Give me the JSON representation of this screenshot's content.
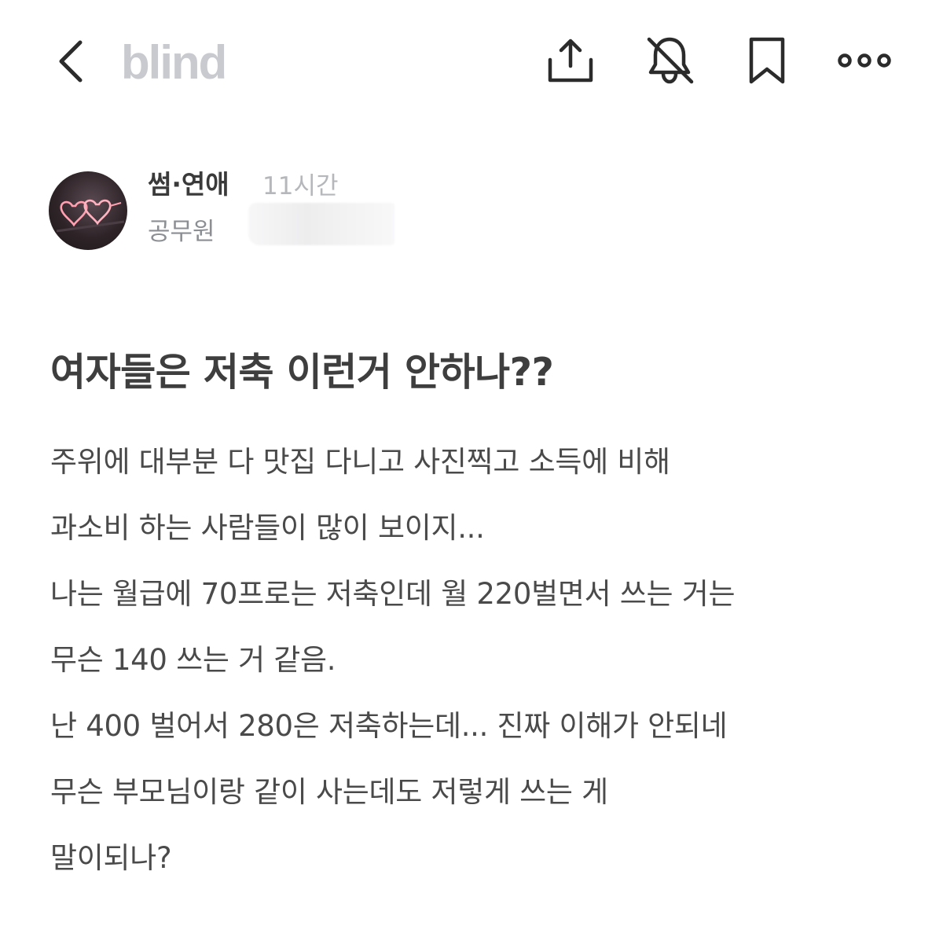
{
  "header": {
    "logo_text": "blind",
    "icons": {
      "back": "chevron-left-icon",
      "share": "share-icon",
      "notifications": "bell-off-icon",
      "bookmark": "bookmark-icon",
      "more": "more-horizontal-icon"
    },
    "colors": {
      "logo": "#c9cacf",
      "icon": "#2b2b2b"
    }
  },
  "post": {
    "author": {
      "avatar_icon": "neon-hearts-avatar",
      "category": "썸·연애",
      "time_ago": "11시간",
      "company": "공무원"
    },
    "title": "여자들은 저축 이런거 안하나??",
    "body_lines": [
      "주위에 대부분 다 맛집 다니고 사진찍고 소득에 비해",
      "과소비 하는 사람들이 많이 보이지...",
      "나는 월급에 70프로는 저축인데 월 220벌면서 쓰는 거는",
      "무슨 140 쓰는 거 같음.",
      "난 400 벌어서 280은 저축하는데... 진짜 이해가 안되네",
      "무슨 부모님이랑 같이 사는데도 저렇게 쓰는 게",
      "말이되나?"
    ]
  }
}
